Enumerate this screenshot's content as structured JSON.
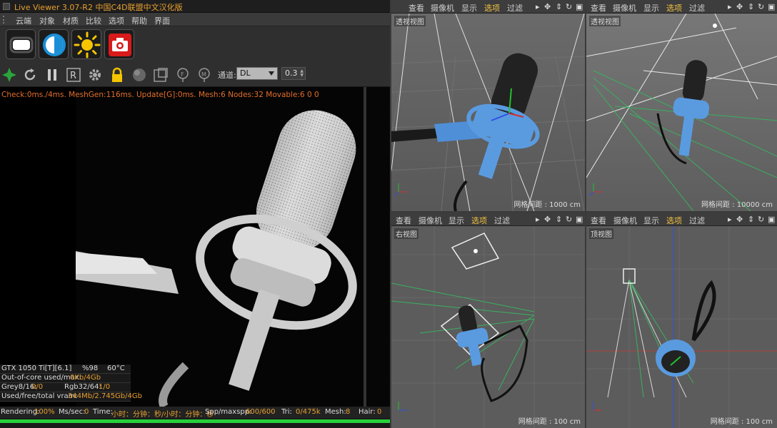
{
  "app": {
    "title": "Live Viewer 3.07-R2 中国C4D联盟中文汉化版"
  },
  "menu": [
    "云端",
    "对象",
    "材质",
    "比较",
    "选项",
    "帮助",
    "界面"
  ],
  "big_buttons": [
    "lamp-icon",
    "contrast-icon",
    "sun-icon",
    "camera-icon"
  ],
  "tools": [
    "octane-icon",
    "refresh-icon",
    "pause-icon",
    "r-icon",
    "gear-icon",
    "lock-icon",
    "sphere-icon",
    "region-icon",
    "focus-icon",
    "material-icon"
  ],
  "channel": {
    "label": "通道:",
    "value": "DL",
    "number": "0.3"
  },
  "status_line": "Check:0ms./4ms. MeshGen:116ms. Update[G]:0ms. Mesh:6 Nodes:32 Movable:6  0 0",
  "gpu": {
    "name": "GTX 1050 Ti[T][6.1]",
    "usage": "%98",
    "temp": "60°C"
  },
  "out_of_core": {
    "label": "Out-of-core used/max:",
    "value": "0Kb/4Gb"
  },
  "grey": {
    "label": "Grey8/16:",
    "value": "0/0",
    "rgb_label": "Rgb32/64:",
    "rgb_value": "1/0"
  },
  "vram": {
    "label": "Used/free/total vram:",
    "value": "344Mb/2.745Gb/4Gb"
  },
  "render_stats": {
    "rendering_label": "Rendering:",
    "rendering_value": "100%",
    "ms_label": "Ms/sec:",
    "ms_value": "0",
    "time_label": "Time:",
    "time_value": "小时：分钟：秒/小时：分钟：秒",
    "spp_label": "Spp/maxspp:",
    "spp_value": "600/600",
    "tri_label": "Tri:",
    "tri_value": "0/475k",
    "mesh_label": "Mesh:",
    "mesh_value": "8",
    "hair_label": "Hair:",
    "hair_value": "0"
  },
  "progress": 1.0,
  "viewports": [
    {
      "menu": [
        "查看",
        "摄像机",
        "显示",
        "选项",
        "过滤"
      ],
      "active": "选项",
      "name": "透视视图",
      "grid": "网格间距 : 1000 cm"
    },
    {
      "menu": [
        "查看",
        "摄像机",
        "显示",
        "选项",
        "过滤"
      ],
      "active": "选项",
      "name": "透视视图",
      "grid": "网格间距 : 10000 cm"
    },
    {
      "menu": [
        "查看",
        "摄像机",
        "显示",
        "选项",
        "过滤"
      ],
      "active": "选项",
      "name": "右视图",
      "grid": "网格间距 : 100 cm"
    },
    {
      "menu": [
        "查看",
        "摄像机",
        "显示",
        "选项",
        "过滤"
      ],
      "active": "选项",
      "name": "顶视图",
      "grid": "网格间距 : 100 cm"
    }
  ],
  "colors": {
    "accent": "#e8a030",
    "status": "#e36e2a",
    "progress": "#26d03a",
    "active_menu": "#f0c040"
  }
}
